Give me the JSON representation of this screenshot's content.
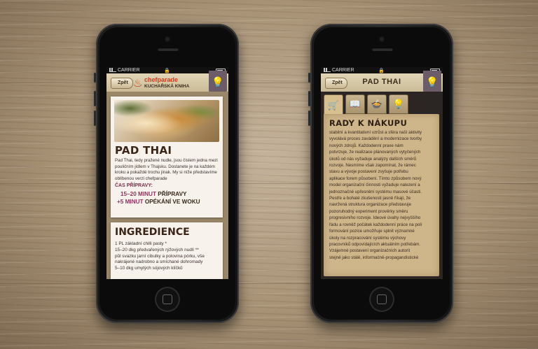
{
  "left_phone": {
    "status": {
      "carrier": "CARRIER"
    },
    "nav": {
      "back_label": "Zpět",
      "brand": "chefparade",
      "brand_sub": "KUCHAŘSKÁ KNIHA"
    },
    "recipe": {
      "title": "PAD THAI",
      "description": [
        "Pad Thai, tedy pražené nudle, jsou číslem jedna mezi",
        "pouličním jídlem v Thajsku. Dostanete je na každém",
        "kroku a pokaždé trochu jinak. My si níže představíme",
        "oblíbenou verzi chefparade"
      ],
      "prep_label": "ČAS PŘÍPRAVY:",
      "prep1_time": "15–20 MINUT",
      "prep1_text": " PŘÍPRAVY",
      "prep2_time": "+5 MINUT",
      "prep2_text": " OPÉKÁNÍ VE WOKU"
    },
    "ingredients": {
      "title": "INGREDIENCE",
      "items": [
        "1 PL základní chilli pasty *",
        "15–20 dkg předvařených rýžových nudlí **",
        "půl svazku jarní cibulky a polovina pórku, vše",
        "nakrájené nadrobno a smíchané dohromady",
        "5–10 dkg umytých sójových klíčků"
      ]
    }
  },
  "right_phone": {
    "status": {
      "carrier": "CARRIER"
    },
    "nav": {
      "back_label": "Zpět",
      "title": "PAD THAI"
    },
    "tabs": [
      "cart-icon",
      "book-icon",
      "pot-icon",
      "bulb-icon"
    ],
    "tips": {
      "title": "RADY K NÁKUPU",
      "lines": [
        "stabilní a kvantitativní vzrůst a sféra naší aktivity",
        "vyvolává proces zavádění a modernizace tvorby",
        "nových zdrojů. Každodenní praxe nám",
        "potvrzuje, že realizace plánovaných vytyčených",
        "úkolů od nás vyžaduje analýzy dalších směrů",
        "rozvoje. Nesmíme však zapomínat, že rámec",
        "stavu a vývoje postavení zvyšuje potřebu",
        "aplikace forem působení. Tímto způsobem nový",
        "model organizační činnosti vyžaduje nalezení a",
        "jednoznačné upřesnění systému masové účasti.",
        "Pestře a bohaté zkušenosti jasně říkají, že",
        "navržená struktura organizace představuje",
        "pozoruhodný experiment prověrky směru",
        "progresivního rozvoje. Ideové úvahy nejvyššího",
        "řádu a rovněž počátek každodenní práce na poli",
        "formování pozice umožňuje splnit významné",
        "úkoly na rozpracování systému výchovy",
        "pracovníků odpovídajících aktuálním potřebám.",
        "Vzájemné postavení organizačních autorit",
        "stejně jako stálé, informačně-propagandistické"
      ]
    }
  }
}
